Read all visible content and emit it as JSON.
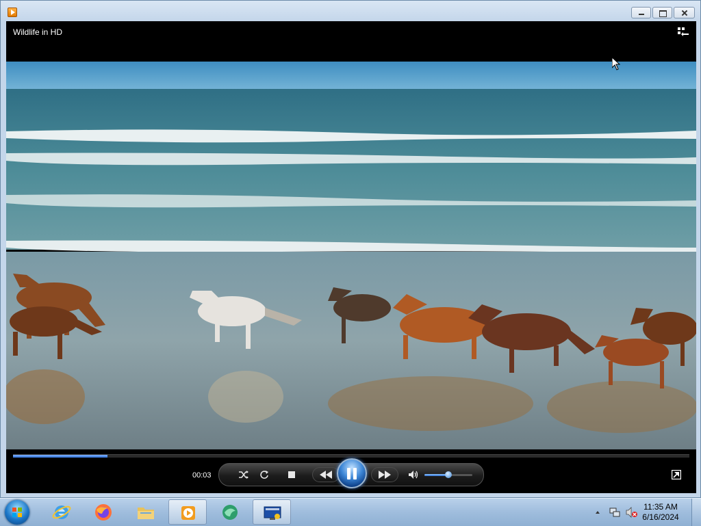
{
  "window": {
    "title_icon": "windows-media-player-icon",
    "media_title": "Wildlife in HD",
    "buttons": [
      "minimize",
      "restore",
      "close"
    ]
  },
  "player": {
    "time_elapsed": "00:03",
    "seek_progress": 0.14,
    "volume_level": 0.5,
    "state": "playing",
    "controls": [
      "shuffle",
      "repeat",
      "stop",
      "previous",
      "play-pause",
      "next",
      "mute",
      "volume",
      "fullscreen"
    ]
  },
  "colors": {
    "accent": "#3c86d6",
    "player_bg": "#000000",
    "taskbar": "#9fbddd"
  },
  "taskbar": {
    "items": [
      {
        "name": "internet-explorer",
        "icon": "internet-explorer-icon",
        "active": false
      },
      {
        "name": "firefox",
        "icon": "firefox-icon",
        "active": false
      },
      {
        "name": "file-explorer",
        "icon": "folder-icon",
        "active": false
      },
      {
        "name": "windows-media-player",
        "icon": "media-player-icon",
        "active": true
      },
      {
        "name": "app-green",
        "icon": "green-app-icon",
        "active": false
      },
      {
        "name": "remote-desktop",
        "icon": "remote-desktop-icon",
        "active": true
      }
    ],
    "clock": {
      "time": "11:35 AM",
      "date": "6/16/2024"
    }
  }
}
